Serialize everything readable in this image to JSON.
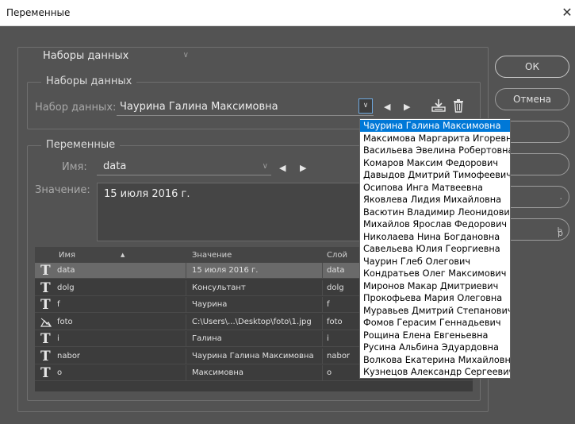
{
  "window": {
    "title": "Переменные",
    "close_glyph": "✕"
  },
  "mode_select": {
    "value": "Наборы данных"
  },
  "datasets_group": {
    "title": "Наборы данных",
    "dataset_label": "Набор данных:",
    "dataset_value": "Чаурина Галина Максимовна"
  },
  "variables_group": {
    "title": "Переменные",
    "name_label": "Имя:",
    "name_value": "data",
    "value_label": "Значение:",
    "value_text": "15 июля 2016 г."
  },
  "table": {
    "headers": {
      "name": "Имя",
      "sort": "▲",
      "value": "Значение",
      "layer": "Слой"
    },
    "rows": [
      {
        "icon": "text-variable-icon",
        "name": "data",
        "value": "15 июля 2016 г.",
        "layer": "data"
      },
      {
        "icon": "text-variable-icon",
        "name": "dolg",
        "value": "Консультант",
        "layer": "dolg"
      },
      {
        "icon": "text-variable-icon",
        "name": "f",
        "value": "Чаурина",
        "layer": "f"
      },
      {
        "icon": "image-variable-icon",
        "name": "foto",
        "value": "C:\\Users\\...\\Desktop\\foto\\1.jpg",
        "layer": "foto"
      },
      {
        "icon": "text-variable-icon",
        "name": "i",
        "value": "Галина",
        "layer": "i"
      },
      {
        "icon": "text-variable-icon",
        "name": "nabor",
        "value": "Чаурина Галина Максимовна",
        "layer": "nabor"
      },
      {
        "icon": "text-variable-icon",
        "name": "o",
        "value": "Максимовна",
        "layer": "o"
      }
    ]
  },
  "buttons": {
    "ok": "ОК",
    "cancel": "Отмена",
    "stub_5": "ь",
    "stub_text": "р"
  },
  "dropdown": {
    "items": [
      "Чаурина Галина Максимовна",
      "Максимова Маргарита Игоревна",
      "Васильева Эвелина Робертовна",
      "Комаров Максим Федорович",
      "Давыдов Дмитрий Тимофеевич",
      "Осипова Инга Матвеевна",
      "Яковлева Лидия Михайловна",
      "Васютин Владимир Леонидович",
      "Михайлов Ярослав Федорович",
      "Николаева Нина Богдановна",
      "Савельева Юлия Георгиевна",
      "Чаурин Глеб Олегович",
      "Кондратьев Олег Максимович",
      "Миронов Макар Дмитриевич",
      "Прокофьева Мария Олеговна",
      "Муравьев Дмитрий Степанович",
      "Фомов Герасим Геннадьевич",
      "Рощина Елена Евгеньевна",
      "Русина Альбина Эдуардовна",
      "Волкова Екатерина  Михайловна",
      "Кузнецов Александр Сергеевич"
    ],
    "active_index": 0
  },
  "colors": {
    "accent": "#0078d7",
    "panel": "#535353",
    "table_bg": "#3c3c3c"
  }
}
